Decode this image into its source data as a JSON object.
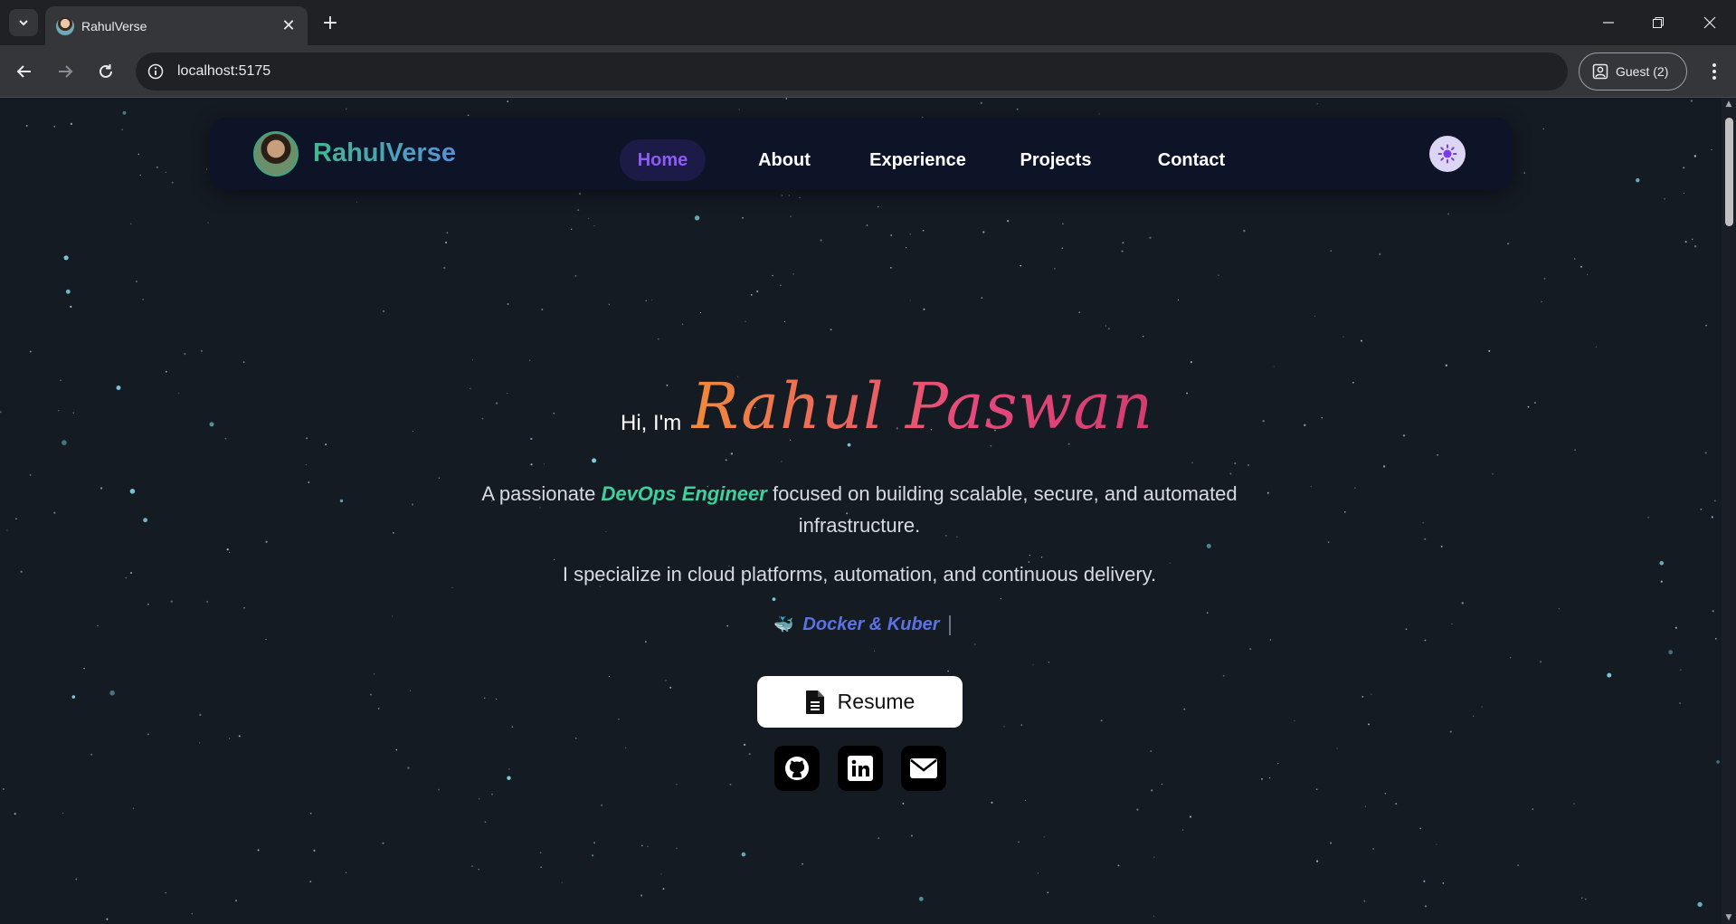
{
  "browser": {
    "tab_title": "RahulVerse",
    "url": "localhost:5175",
    "profile_label": "Guest (2)"
  },
  "navbar": {
    "brand": "RahulVerse",
    "links": [
      {
        "label": "Home",
        "active": true
      },
      {
        "label": "About",
        "active": false
      },
      {
        "label": "Experience",
        "active": false
      },
      {
        "label": "Projects",
        "active": false
      },
      {
        "label": "Contact",
        "active": false
      }
    ],
    "theme_icon": "sun-icon"
  },
  "hero": {
    "greeting": "Hi, I'm",
    "name": "Rahul Paswan",
    "intro_prefix": "A passionate",
    "intro_accent": "DevOps Engineer",
    "intro_suffix": "focused on building scalable, secure, and automated infrastructure.",
    "specialize": "I specialize in cloud platforms, automation, and continuous delivery.",
    "typing_emoji": "🐳",
    "typing_text": "Docker & Kuber",
    "resume_label": "Resume",
    "socials": [
      "github-icon",
      "linkedin-icon",
      "mail-icon"
    ]
  },
  "colors": {
    "page_bg": "#151b23",
    "accent_green": "#3fd19c",
    "active_nav": "#8b5cf6",
    "typing_blue": "#5b72e6"
  }
}
